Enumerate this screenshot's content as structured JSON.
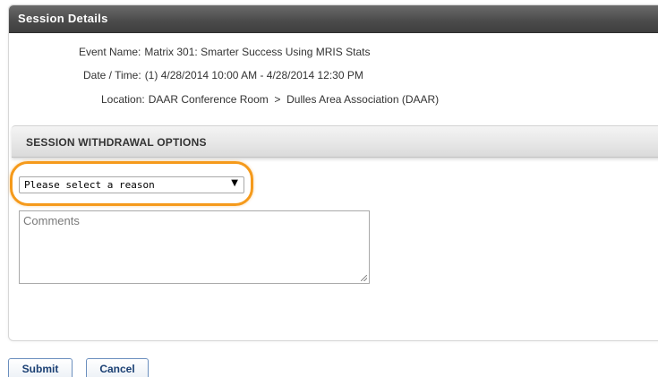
{
  "panel": {
    "title": "Session Details"
  },
  "details": {
    "event_name_label": "Event Name:",
    "event_name_value": "Matrix 301: Smarter Success Using MRIS Stats",
    "datetime_label": "Date / Time:",
    "datetime_value": "(1) 4/28/2014 10:00 AM - 4/28/2014 12:30 PM",
    "location_label": "Location:",
    "location_value": "DAAR Conference Room  >  Dulles Area Association (DAAR)"
  },
  "withdrawal": {
    "section_title": "SESSION WITHDRAWAL OPTIONS",
    "reason_select_value": "Please select a reason",
    "comments_placeholder": "Comments"
  },
  "actions": {
    "submit_label": "Submit",
    "cancel_label": "Cancel"
  },
  "colors": {
    "header_bg": "#4a4a4a",
    "highlight": "#f59a1b",
    "button_text": "#1a3f73"
  },
  "icons": {
    "select_arrow": "dropdown-arrow-icon",
    "resize_grip": "resize-grip-icon"
  }
}
